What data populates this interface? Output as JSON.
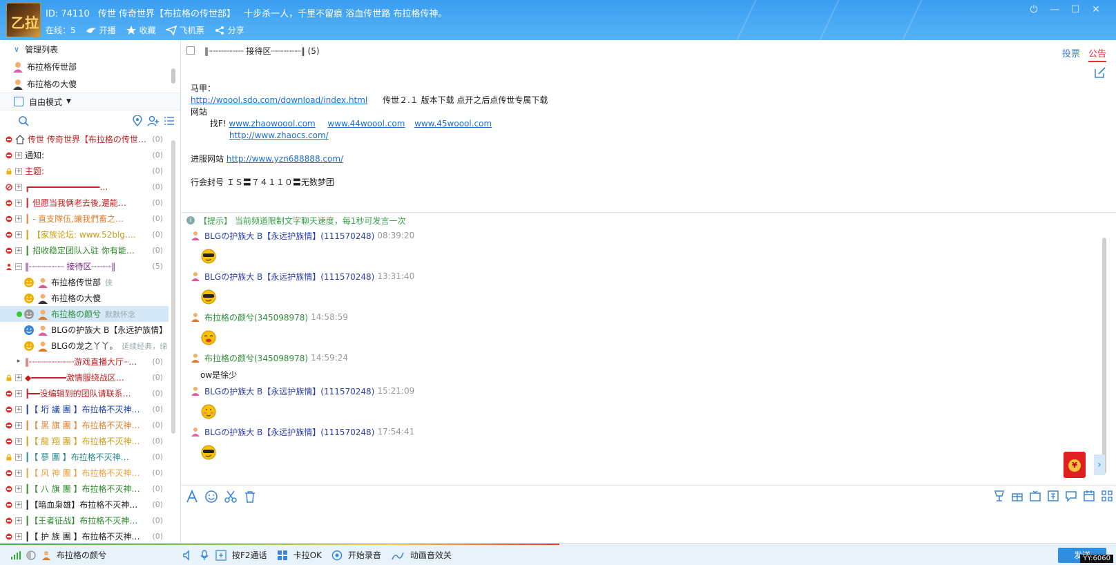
{
  "header": {
    "logo_text": "乙拉",
    "id_label": "ID: 74110",
    "channel_name": "传世 传奇世界【布拉格の传世部】",
    "slogan": "十步杀一人，千里不留痕 浴血传世路 布拉格传神。",
    "online": "在线：5",
    "actions": [
      "开播",
      "收藏",
      "飞机票",
      "分享"
    ],
    "window_controls": [
      "⏻",
      "—",
      "☐",
      "✕"
    ]
  },
  "left": {
    "manage_title": "管理列表",
    "managers": [
      "布拉格传世部",
      "布拉格の大傻"
    ],
    "mode": "自由模式",
    "tree": [
      {
        "name": "传世  传奇世界【布拉格の传世…",
        "count": "(0)",
        "color": "#c02020",
        "status": "no",
        "icon": "home"
      },
      {
        "name": "通知:",
        "count": "(0)",
        "color": "#222222",
        "status": "no",
        "icon": "plus"
      },
      {
        "name": "主题:",
        "count": "(0)",
        "color": "#c02020",
        "status": "lock",
        "icon": "plus"
      },
      {
        "name": "┏━━━━━━━━━━━━━━…",
        "count": "(0)",
        "color": "#c02020",
        "status": "ban",
        "icon": "plus"
      },
      {
        "name": "┃       但愿当我俩老去後,還能…",
        "count": "(0)",
        "color": "#c02020",
        "status": "no",
        "icon": "plus"
      },
      {
        "name": "┃       - 直支隊伍,讓我們畜之…",
        "count": "(0)",
        "color": "#e08030",
        "status": "no",
        "icon": "plus"
      },
      {
        "name": "┃     【家族论坛: www.52blg.…",
        "count": "(0)",
        "color": "#c9a010",
        "status": "no",
        "icon": "plus"
      },
      {
        "name": "┃ 招收稳定团队入驻 你有能…",
        "count": "(0)",
        "color": "#2a8a2a",
        "status": "no",
        "icon": "plus"
      },
      {
        "name": "‖┈┈┈┈┈┈┈  接待区┈┈┈┈‖",
        "count": "(5)",
        "color": "#7a1f8a",
        "status": "user",
        "icon": "minus"
      }
    ],
    "members": [
      {
        "name": "布拉格传世部",
        "extra": "侠",
        "color": "#222222",
        "selected": false
      },
      {
        "name": "布拉格の大傻",
        "extra": "",
        "color": "#222222",
        "selected": false
      },
      {
        "name": "布拉格の颜兮",
        "extra": "默默怀念",
        "color": "#2f8f3a",
        "selected": true
      },
      {
        "name": "BLGの护族大 B【永远护族情】",
        "extra": "!",
        "color": "#222222",
        "selected": false
      },
      {
        "name": "BLGの龙之丫丫。",
        "extra": "延续经典，缔",
        "color": "#222222",
        "selected": false
      }
    ],
    "tree2": [
      {
        "name": "‖┈┈┈┈┈┈┈┈┈游戏直播大厅┈…",
        "count": "(0)",
        "color": "#c02020",
        "status": "none",
        "icon": "arrow"
      },
      {
        "name": "◆━━━━━━━激情服绕战区…",
        "count": "(0)",
        "color": "#c02020",
        "status": "lock",
        "icon": "plus"
      },
      {
        "name": "┣━━没编辑到的团队请联系…",
        "count": "(0)",
        "color": "#c02020",
        "status": "no",
        "icon": "plus"
      },
      {
        "name": "┃【 垳 議 團 】布拉格不灭神…",
        "count": "(0)",
        "color": "#1a3fa8",
        "status": "no",
        "icon": "plus"
      },
      {
        "name": "┃【 黑 旗 團 】布拉格不灭神…",
        "count": "(0)",
        "color": "#e08030",
        "status": "no",
        "icon": "plus"
      },
      {
        "name": "┃【 龍 翔 團 】布拉格不灭神…",
        "count": "(0)",
        "color": "#c9a010",
        "status": "no",
        "icon": "plus"
      },
      {
        "name": "┃【 蓼         團 】布拉格不灭神…",
        "count": "(0)",
        "color": "#2a8a8a",
        "status": "lock",
        "icon": "plus"
      },
      {
        "name": "┃【 风 神 團 】布拉格不灭神…",
        "count": "(0)",
        "color": "#e8a040",
        "status": "no",
        "icon": "plus"
      },
      {
        "name": "┃【 八 旗 團 】布拉格不灭神…",
        "count": "(0)",
        "color": "#2a8a2a",
        "status": "no",
        "icon": "plus"
      },
      {
        "name": "┃【暗血枭雄】布拉格不灭神…",
        "count": "(0)",
        "color": "#222222",
        "status": "no",
        "icon": "plus"
      },
      {
        "name": "┃【王者征战】布拉格不灭神…",
        "count": "(0)",
        "color": "#2a8a2a",
        "status": "no",
        "icon": "plus"
      },
      {
        "name": "┃【 护 族 團 】布拉格不灭神…",
        "count": "(0)",
        "color": "#222222",
        "status": "no",
        "icon": "plus"
      }
    ]
  },
  "right": {
    "channel_title": "‖┈┈┈┈┈┈┈  接待区┈┈┈┈┈┈‖ (5)",
    "tab_vote": "投票",
    "tab_notice": "公告",
    "notice": {
      "line1": "马甲：",
      "link1": "http://woool.sdo.com/download/index.html",
      "line2_text": "传世２.１ 版本下载  点开之后点传世专属下载",
      "line3": "网站",
      "find_label": "找F!",
      "link2": "www.zhaowoool.com",
      "link3": "www.44woool.com",
      "link4": "www.45woool.com",
      "link5": "http://www.zhaocs.com/",
      "enter_label": "进服网站",
      "link6": "http://www.yzn688888.com/",
      "guild_line": "行会封号 ＩＳ〓７４１１０〓无数梦团"
    },
    "tip": "【提示】 当前频道限制文字聊天速度，每1秒可发言一次",
    "messages": [
      {
        "name": "BLGの护族大 B【永远护族情】(111570248)",
        "time": "08:39:20",
        "type": "emoji",
        "emoji": "cool",
        "green": false
      },
      {
        "name": "BLGの护族大 B【永远护族情】(111570248)",
        "time": "13:31:40",
        "type": "emoji",
        "emoji": "cool",
        "green": false
      },
      {
        "name": "布拉格の颜兮(345098978)",
        "time": "14:58:59",
        "type": "emoji",
        "emoji": "kiss",
        "green": true
      },
      {
        "name": "布拉格の颜兮(345098978)",
        "time": "14:59:24",
        "type": "text",
        "text": "ow是徐少",
        "green": true
      },
      {
        "name": "BLGの护族大 B【永远护族情】(111570248)",
        "time": "15:21:09",
        "type": "emoji",
        "emoji": "shy",
        "green": false
      },
      {
        "name": "BLGの护族大 B【永远护族情】(111570248)",
        "time": "17:54:41",
        "type": "emoji",
        "emoji": "cool",
        "green": false
      }
    ],
    "red_envelope": "¥"
  },
  "footer": {
    "user": "布拉格の颜兮",
    "f2": "按F2通话",
    "karaoke": "卡拉OK",
    "record": "开始录音",
    "anim": "动画音效关",
    "send": "发送",
    "stamp": "YY:6060"
  }
}
